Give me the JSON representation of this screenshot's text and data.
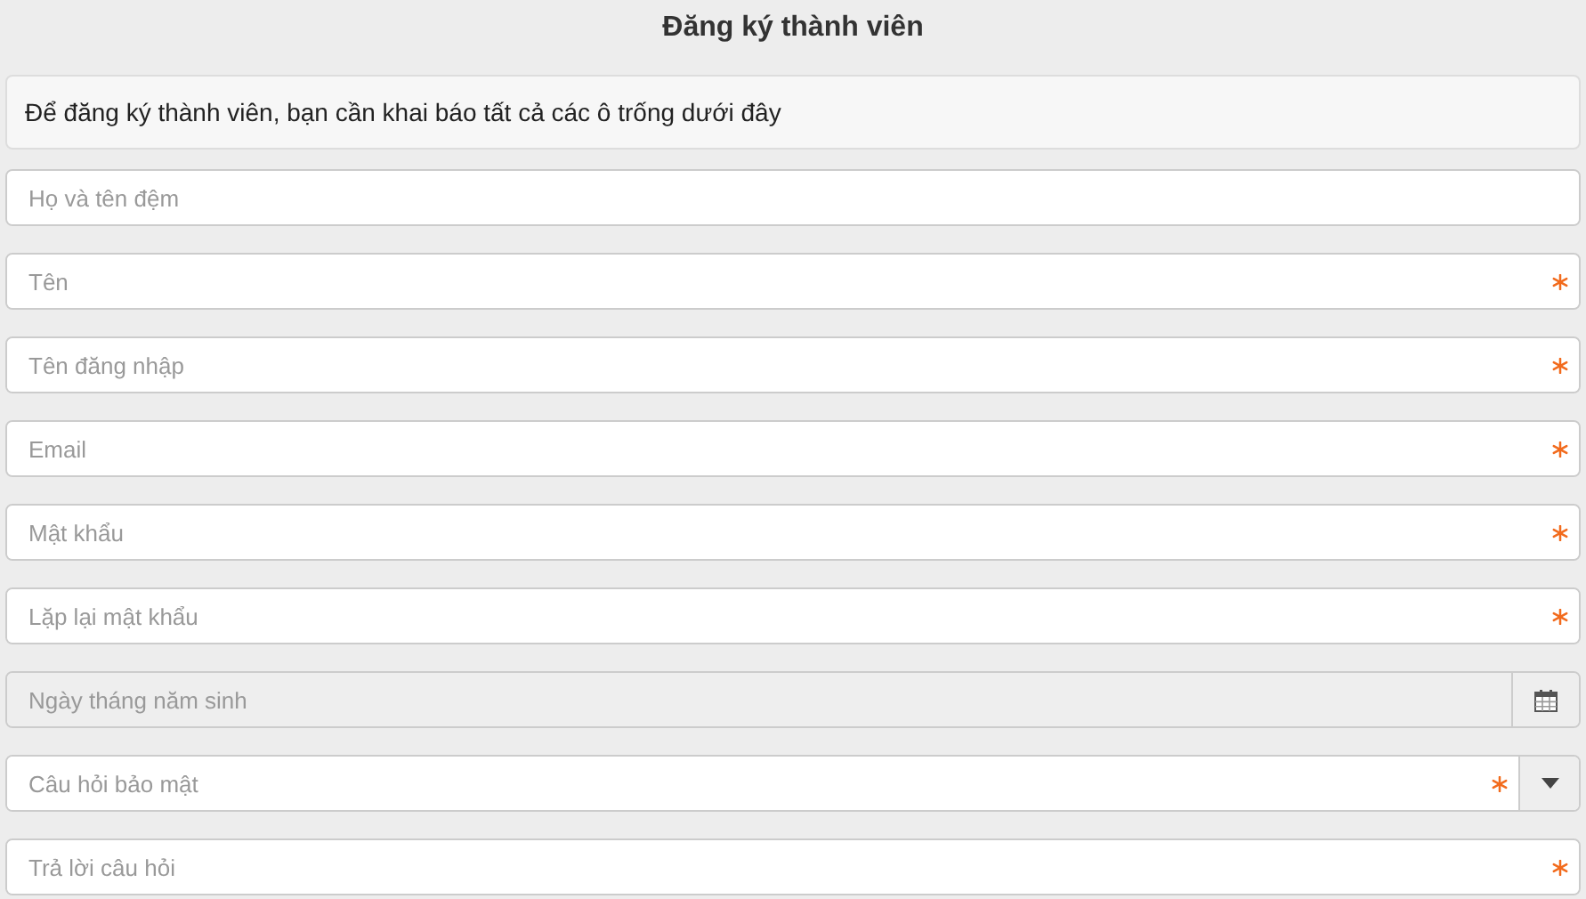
{
  "title": "Đăng ký thành viên",
  "notice": "Để đăng ký thành viên, bạn cần khai báo tất cả các ô trống dưới đây",
  "fields": [
    {
      "kind": "text",
      "placeholder": "Họ và tên đệm",
      "required": false
    },
    {
      "kind": "text",
      "placeholder": "Tên",
      "required": true
    },
    {
      "kind": "text",
      "placeholder": "Tên đăng nhập",
      "required": true
    },
    {
      "kind": "text",
      "placeholder": "Email",
      "required": true
    },
    {
      "kind": "text",
      "placeholder": "Mật khẩu",
      "required": true
    },
    {
      "kind": "text",
      "placeholder": "Lặp lại mật khẩu",
      "required": true
    },
    {
      "kind": "date",
      "placeholder": "Ngày tháng năm sinh",
      "required": false
    },
    {
      "kind": "select",
      "placeholder": "Câu hỏi bảo mật",
      "required": true
    },
    {
      "kind": "text",
      "placeholder": "Trả lời câu hỏi",
      "required": true
    }
  ]
}
